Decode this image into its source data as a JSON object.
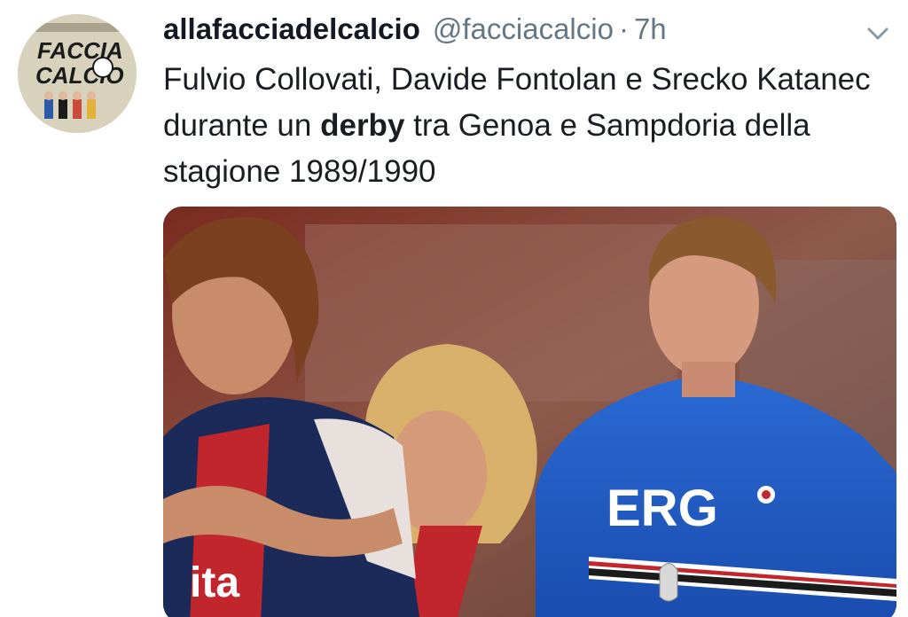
{
  "tweet": {
    "display_name": "allafacciadelcalcio",
    "handle": "@facciacalcio",
    "separator": "·",
    "time": "7h",
    "text_part1": "Fulvio Collovati, Davide Fontolan e Srecko Katanec durante un ",
    "text_bold": "derby",
    "text_part2": " tra Genoa e Sampdoria della stagione 1989/1990",
    "avatar_text_line1": "FACCIA",
    "avatar_text_line2": "CALCIO",
    "photo_jersey_text": "ERG",
    "photo_sponsor_text": "ita"
  },
  "icons": {
    "menu": "chevron-down-icon",
    "avatar": "avatar-logo-icon"
  },
  "colors": {
    "name": "#141823",
    "secondary": "#657786",
    "text": "#1a1d22",
    "sampdoria_blue": "#1e5bc6",
    "genoa_red": "#c0262b",
    "genoa_navy": "#1c2a5a"
  }
}
